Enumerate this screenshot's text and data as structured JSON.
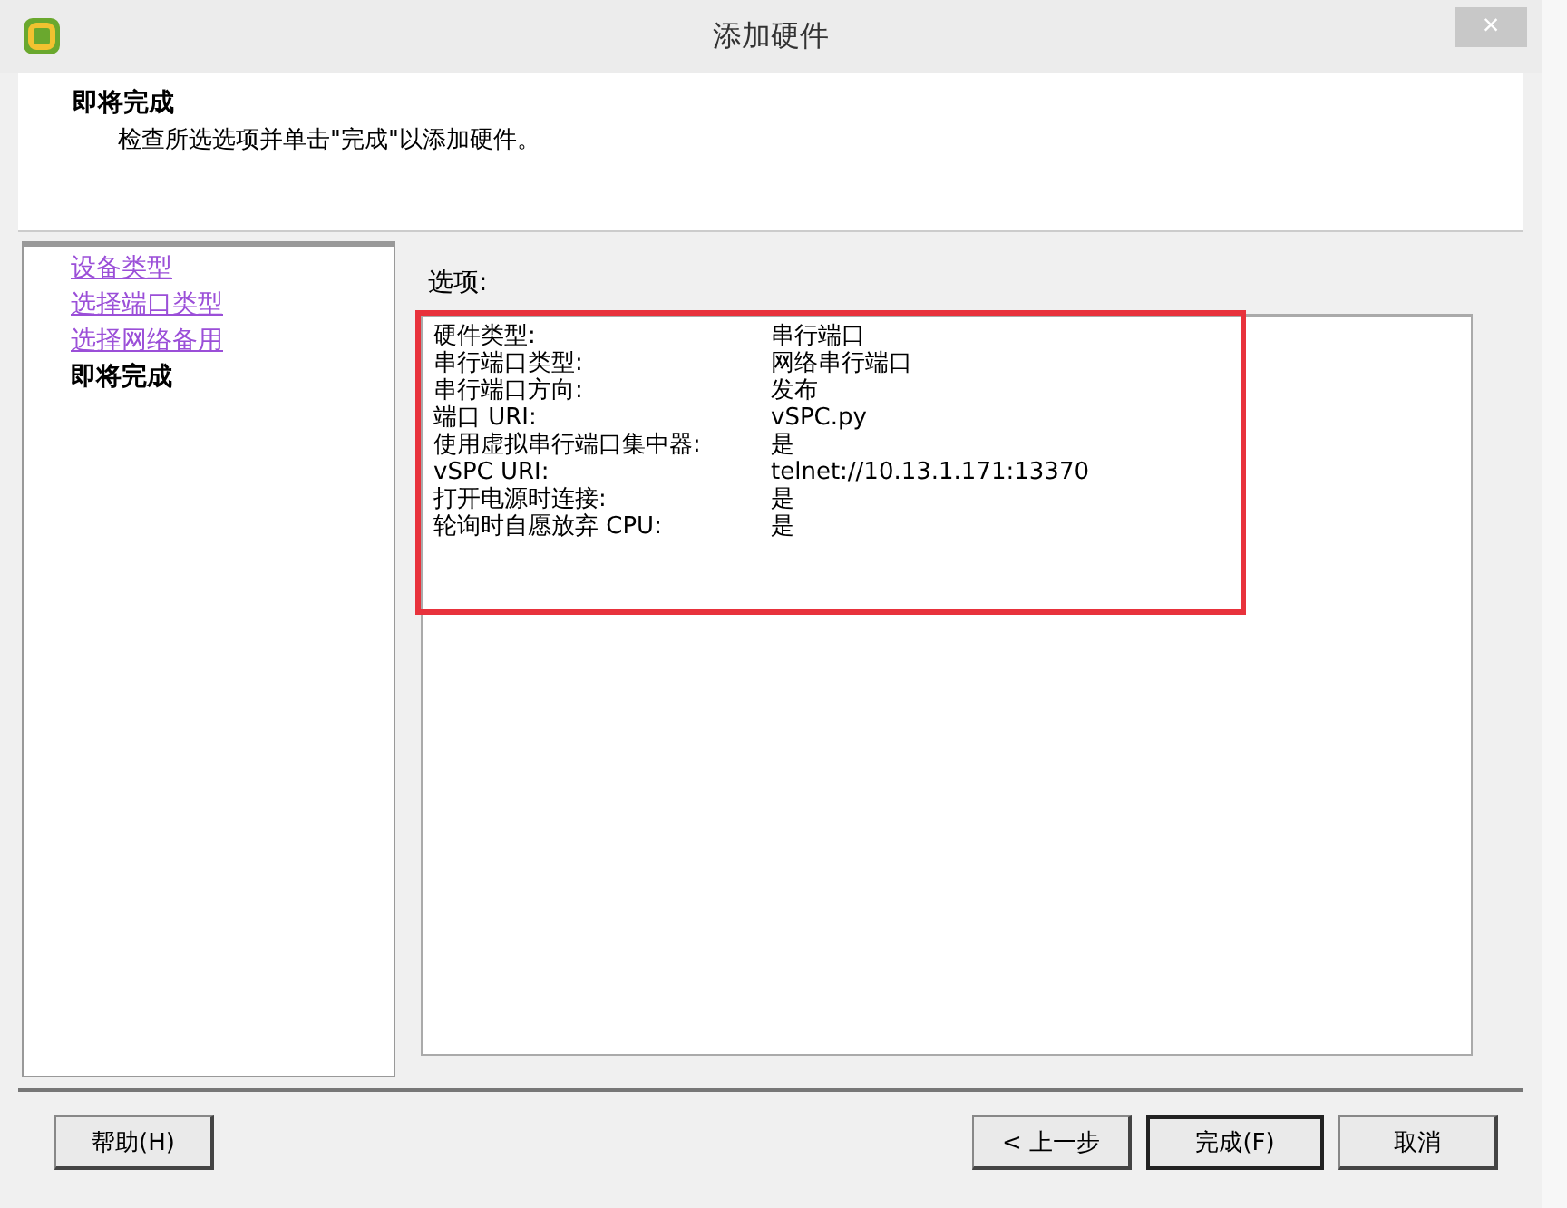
{
  "window": {
    "title": "添加硬件",
    "close": "×"
  },
  "header": {
    "title": "即将完成",
    "subtitle": "检查所选选项并单击\"完成\"以添加硬件。"
  },
  "steps": [
    {
      "label": "设备类型",
      "selected": false
    },
    {
      "label": "选择端口类型",
      "selected": false
    },
    {
      "label": "选择网络备用",
      "selected": false
    },
    {
      "label": "即将完成",
      "selected": true
    }
  ],
  "options": {
    "label": "选项:",
    "highlighted": true,
    "rows": [
      {
        "name": "硬件类型:",
        "value": "串行端口"
      },
      {
        "name": "串行端口类型:",
        "value": "网络串行端口"
      },
      {
        "name": "串行端口方向:",
        "value": "发布"
      },
      {
        "name": "端口 URI:",
        "value": "vSPC.py"
      },
      {
        "name": "使用虚拟串行端口集中器:",
        "value": "是"
      },
      {
        "name": "vSPC URI:",
        "value": "telnet://10.13.1.171:13370"
      },
      {
        "name": "打开电源时连接:",
        "value": "是"
      },
      {
        "name": "轮询时自愿放弃 CPU:",
        "value": "是"
      }
    ]
  },
  "buttons": {
    "help": "帮助(H)",
    "back": "< 上一步",
    "finish": "完成(F)",
    "cancel": "取消"
  }
}
